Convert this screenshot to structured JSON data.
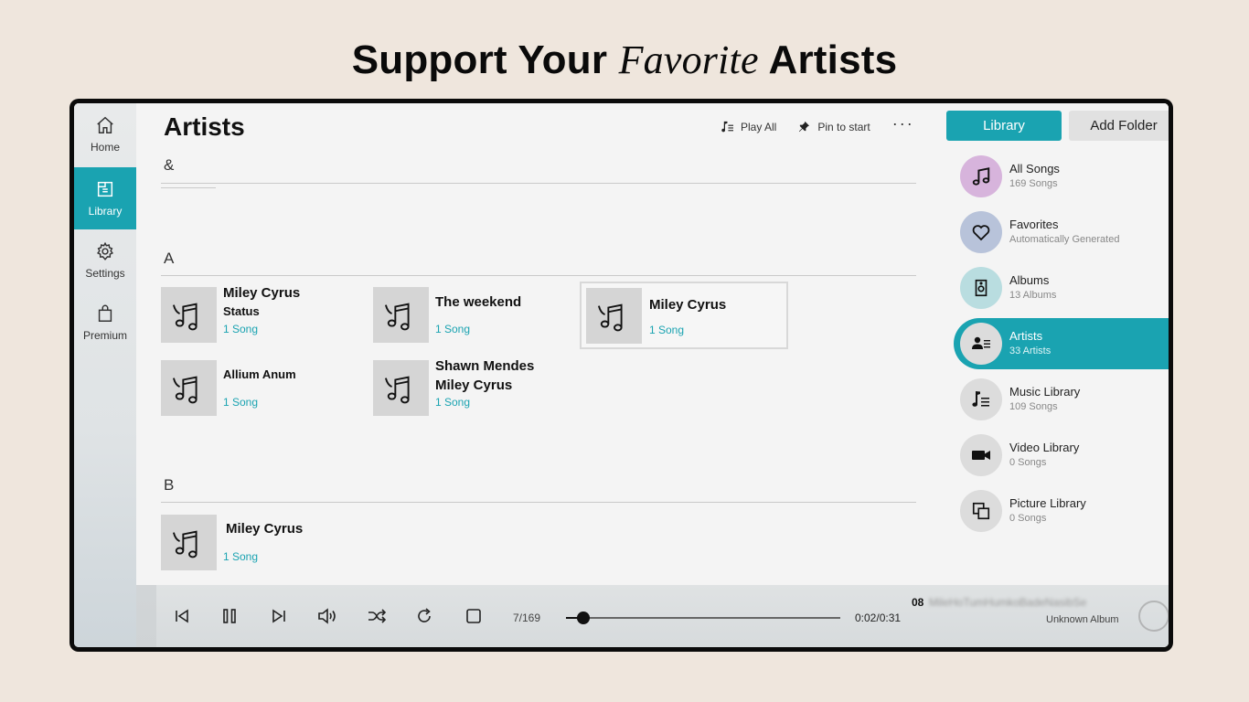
{
  "headline": {
    "part1": "Support Your ",
    "italic": "Favorite",
    "part2": " Artists"
  },
  "nav": {
    "items": [
      {
        "label": "Home",
        "icon": "home-icon"
      },
      {
        "label": "Library",
        "icon": "library-icon"
      },
      {
        "label": "Settings",
        "icon": "gear-icon"
      },
      {
        "label": "Premium",
        "icon": "shopping-bag-icon"
      }
    ],
    "active": "Library"
  },
  "main": {
    "title": "Artists",
    "toolbar": {
      "play_all": "Play All",
      "pin_to_start": "Pin to start",
      "more": "···"
    },
    "sections": [
      {
        "letter": "&",
        "artists": []
      },
      {
        "letter": "A",
        "artists": [
          {
            "name": "Miley Cyrus",
            "name2": "Status",
            "count": "1 Song"
          },
          {
            "name": "The weekend",
            "count": "1 Song"
          },
          {
            "name": "Miley Cyrus",
            "count": "1 Song",
            "selected": true
          },
          {
            "name": "Allium Anum",
            "count": "1 Song"
          },
          {
            "name": "Shawn Mendes",
            "name2": "Miley Cyrus",
            "count": "1 Song"
          }
        ]
      },
      {
        "letter": "B",
        "artists": [
          {
            "name": "Miley Cyrus",
            "count": "1 Song"
          }
        ]
      }
    ]
  },
  "right": {
    "library_button": "Library",
    "add_folder_button": "Add Folder",
    "items": [
      {
        "title": "All Songs",
        "sub": "169 Songs",
        "icon": "music-notes-icon",
        "color": "#d7b4dc"
      },
      {
        "title": "Favorites",
        "sub": "Automatically Generated",
        "icon": "heart-icon",
        "color": "#b8c3da"
      },
      {
        "title": "Albums",
        "sub": "13 Albums",
        "icon": "speaker-icon",
        "color": "#b9dde0"
      },
      {
        "title": "Artists",
        "sub": "33 Artists",
        "icon": "artist-icon",
        "color": "#dcdcdc"
      },
      {
        "title": "Music Library",
        "sub": "109 Songs",
        "icon": "music-list-icon",
        "color": "#dcdcdc"
      },
      {
        "title": "Video Library",
        "sub": "0 Songs",
        "icon": "video-camera-icon",
        "color": "#dcdcdc"
      },
      {
        "title": "Picture Library",
        "sub": "0 Songs",
        "icon": "picture-icon",
        "color": "#dcdcdc"
      }
    ]
  },
  "player": {
    "track_count": "7/169",
    "time": "0:02/0:31",
    "progress": 0.06,
    "track_number": "08",
    "track_title": "MileHoTumHumkoBadeNasibSe",
    "album": "Unknown Album"
  },
  "colors": {
    "accent": "#1aa3b1",
    "background": "#efe6dd"
  }
}
